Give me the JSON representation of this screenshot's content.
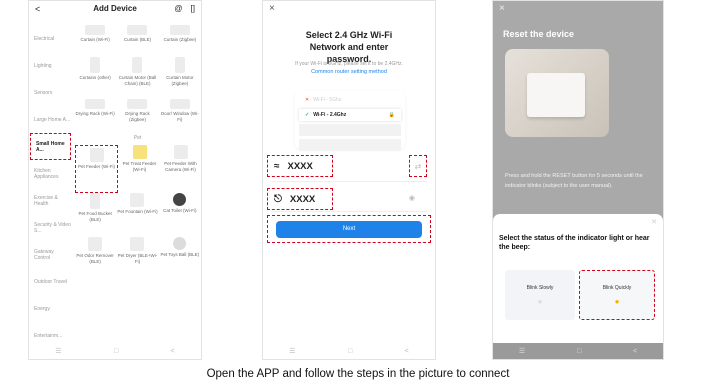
{
  "phone1": {
    "back": "<",
    "title": "Add Device",
    "scan_icon": "@",
    "qr_icon": "[]",
    "categories": [
      "Electrical",
      "Lighting",
      "Sensors",
      "Large Home A...",
      "Small Home A...",
      "Kitchen Appliances",
      "Exercise & Health",
      "Security & Video S...",
      "Gateway Control",
      "Outdoor Travel",
      "Energy",
      "Entertainm..."
    ],
    "rows": [
      [
        "Curtain (Wi-Fi)",
        "Curtain (BLE)",
        "Curtain (Zigbee)"
      ],
      [
        "Curtains (other)",
        "Curtain Motor (Ball Chain) (BLE)",
        "Curtain Motor (Zigbee)"
      ],
      [
        "Drying Rack (Wi-Fi)",
        "Drying Rack (Zigbee)",
        "Door/ Window (Wi-Fi)"
      ],
      [
        "Pet Feeder (Wi-Fi)",
        "Pet Treat Feeder (Wi-Fi)",
        "Pet Feeder With Camera (Wi-Fi)"
      ],
      [
        "Pet Food Bucket (BLE)",
        "Pet Fountain (Wi-Fi)",
        "Cat Toilet (Wi-Fi)"
      ],
      [
        "Pet Odor Remover (BLE)",
        "Pet Dryer (BLE+Wi-Fi)",
        "Pet Toys Ball (BLE)"
      ]
    ],
    "section_pet": "Pet"
  },
  "phone2": {
    "close": "×",
    "title": "Select 2.4 GHz Wi-Fi Network and enter password.",
    "subtitle": "If your Wi-Fi is 5GHz, please set it to be 2.4GHz.",
    "link": "Common router setting method",
    "net_bad": "Wi-Fi - 5Ghz",
    "net_good": "Wi-Fi - 2.4Ghz",
    "ssid": "XXXX",
    "password": "XXXX",
    "next": "Next"
  },
  "phone3": {
    "close": "×",
    "title": "Reset the device",
    "desc": "Press and hold the RESET button for 5 seconds until the indicator blinks (subject to the user manual).",
    "sheet_title": "Select the status of the indicator light or hear the beep:",
    "opt_slow": "Blink Slowly",
    "opt_fast": "Blink Quickly"
  },
  "caption": "Open the APP and follow the steps in the picture to connect"
}
